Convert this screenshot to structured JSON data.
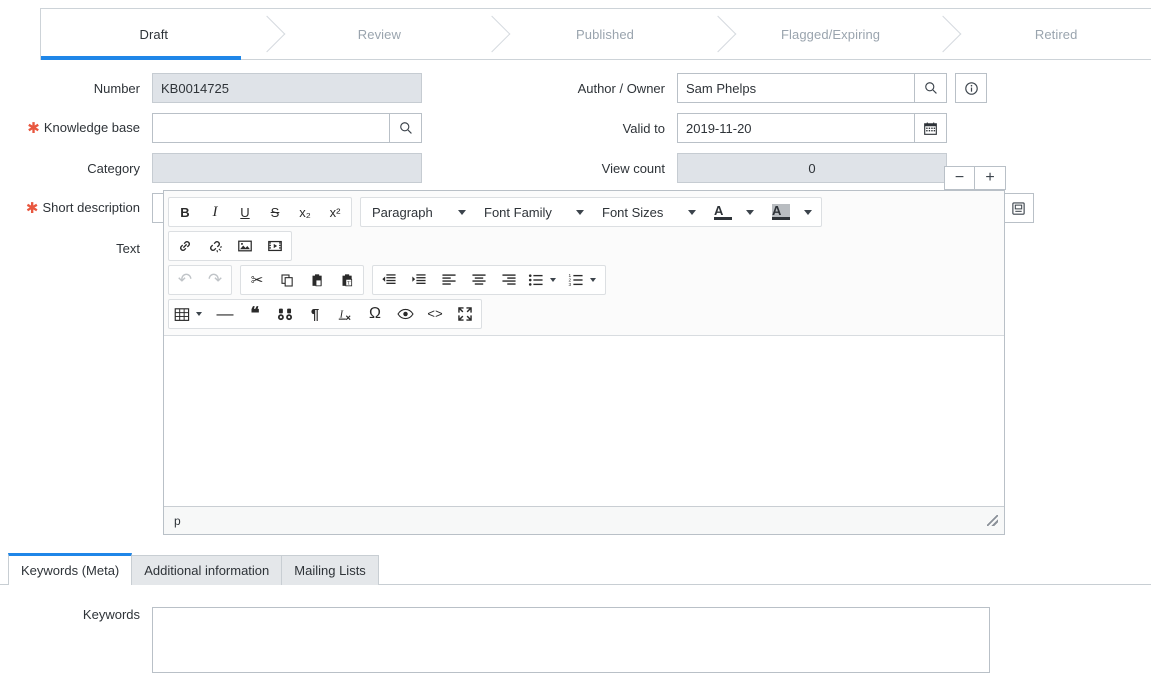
{
  "flow": {
    "steps": [
      {
        "label": "Draft",
        "active": true
      },
      {
        "label": "Review",
        "active": false
      },
      {
        "label": "Published",
        "active": false
      },
      {
        "label": "Flagged/Expiring",
        "active": false
      },
      {
        "label": "Retired",
        "active": false
      }
    ],
    "accent_color": "#1f86e8",
    "inactive_color": "#9aa4ae"
  },
  "form": {
    "left": [
      {
        "label": "Number",
        "value": "KB0014725",
        "required": false,
        "readonly": true,
        "addon": null
      },
      {
        "label": "Knowledge base",
        "value": "",
        "required": true,
        "readonly": false,
        "addon": "search-icon"
      },
      {
        "label": "Category",
        "value": "",
        "required": false,
        "readonly": true,
        "addon": null
      },
      {
        "label": "Short description",
        "value": "",
        "required": true,
        "readonly": false,
        "addon": null
      }
    ],
    "right": [
      {
        "label": "Author / Owner",
        "value": "Sam Phelps",
        "readonly": false,
        "addon": "search-icon",
        "sidebtn": "info-icon"
      },
      {
        "label": "Valid to",
        "value": "2019-11-20",
        "readonly": false,
        "addon": "calendar-icon",
        "sidebtn": null
      },
      {
        "label": "View count",
        "value": "0",
        "readonly": true,
        "addon": null,
        "sidebtn": null
      }
    ],
    "short_description_sidebtn": "template-icon",
    "required_marker": "✱"
  },
  "text_field": {
    "label": "Text",
    "zoom_out_label": "−",
    "zoom_in_label": "+"
  },
  "editor": {
    "toolbar": {
      "row1_format": [
        {
          "name": "bold-icon",
          "glyph": "B"
        },
        {
          "name": "italic-icon",
          "glyph": "I"
        },
        {
          "name": "underline-icon",
          "glyph": "U"
        },
        {
          "name": "strikethrough-icon",
          "glyph": "S"
        },
        {
          "name": "subscript-icon",
          "glyph": "x₂"
        },
        {
          "name": "superscript-icon",
          "glyph": "x²"
        }
      ],
      "row1_selects": [
        {
          "name": "paragraph-format-select",
          "label": "Paragraph"
        },
        {
          "name": "font-family-select",
          "label": "Font Family"
        },
        {
          "name": "font-size-select",
          "label": "Font Sizes"
        },
        {
          "name": "text-color-select",
          "label": "A"
        },
        {
          "name": "background-color-select",
          "label": "A"
        }
      ],
      "row2_insert": [
        {
          "name": "link-icon",
          "glyph": "🔗"
        },
        {
          "name": "unlink-icon",
          "glyph": "⛓"
        },
        {
          "name": "image-icon",
          "glyph": "🖼"
        },
        {
          "name": "video-icon",
          "glyph": "🎞"
        }
      ],
      "row3_history": [
        {
          "name": "undo-icon",
          "glyph": "↶",
          "disabled": true
        },
        {
          "name": "redo-icon",
          "glyph": "↷",
          "disabled": true
        }
      ],
      "row3_clipboard": [
        {
          "name": "cut-icon",
          "glyph": "✂"
        },
        {
          "name": "copy-icon",
          "glyph": "⧉"
        },
        {
          "name": "paste-icon",
          "glyph": "📋"
        },
        {
          "name": "paste-as-text-icon",
          "glyph": "📋"
        }
      ],
      "row3_paragraph": [
        {
          "name": "outdent-icon",
          "glyph": "◧"
        },
        {
          "name": "indent-icon",
          "glyph": "◨"
        },
        {
          "name": "align-left-icon",
          "glyph": "≡"
        },
        {
          "name": "align-center-icon",
          "glyph": "≡"
        },
        {
          "name": "align-right-icon",
          "glyph": "≡"
        },
        {
          "name": "bulleted-list-icon",
          "glyph": "•≡"
        },
        {
          "name": "numbered-list-icon",
          "glyph": "1≡"
        }
      ],
      "row4_tools": [
        {
          "name": "table-icon",
          "glyph": "▦"
        },
        {
          "name": "horizontal-rule-icon",
          "glyph": "—"
        },
        {
          "name": "blockquote-icon",
          "glyph": "❝"
        },
        {
          "name": "find-replace-icon",
          "glyph": "🔎"
        },
        {
          "name": "show-blocks-icon",
          "glyph": "¶"
        },
        {
          "name": "remove-format-icon",
          "glyph": "Ix"
        },
        {
          "name": "special-character-icon",
          "glyph": "Ω"
        },
        {
          "name": "preview-icon",
          "glyph": "👁"
        },
        {
          "name": "source-code-icon",
          "glyph": "<>"
        },
        {
          "name": "maximize-icon",
          "glyph": "⤢"
        }
      ]
    },
    "content": "",
    "status_path": "p"
  },
  "bottom_tabs": {
    "items": [
      {
        "label": "Keywords (Meta)",
        "active": true
      },
      {
        "label": "Additional information",
        "active": false
      },
      {
        "label": "Mailing Lists",
        "active": false
      }
    ],
    "keywords_label": "Keywords",
    "keywords_value": ""
  }
}
